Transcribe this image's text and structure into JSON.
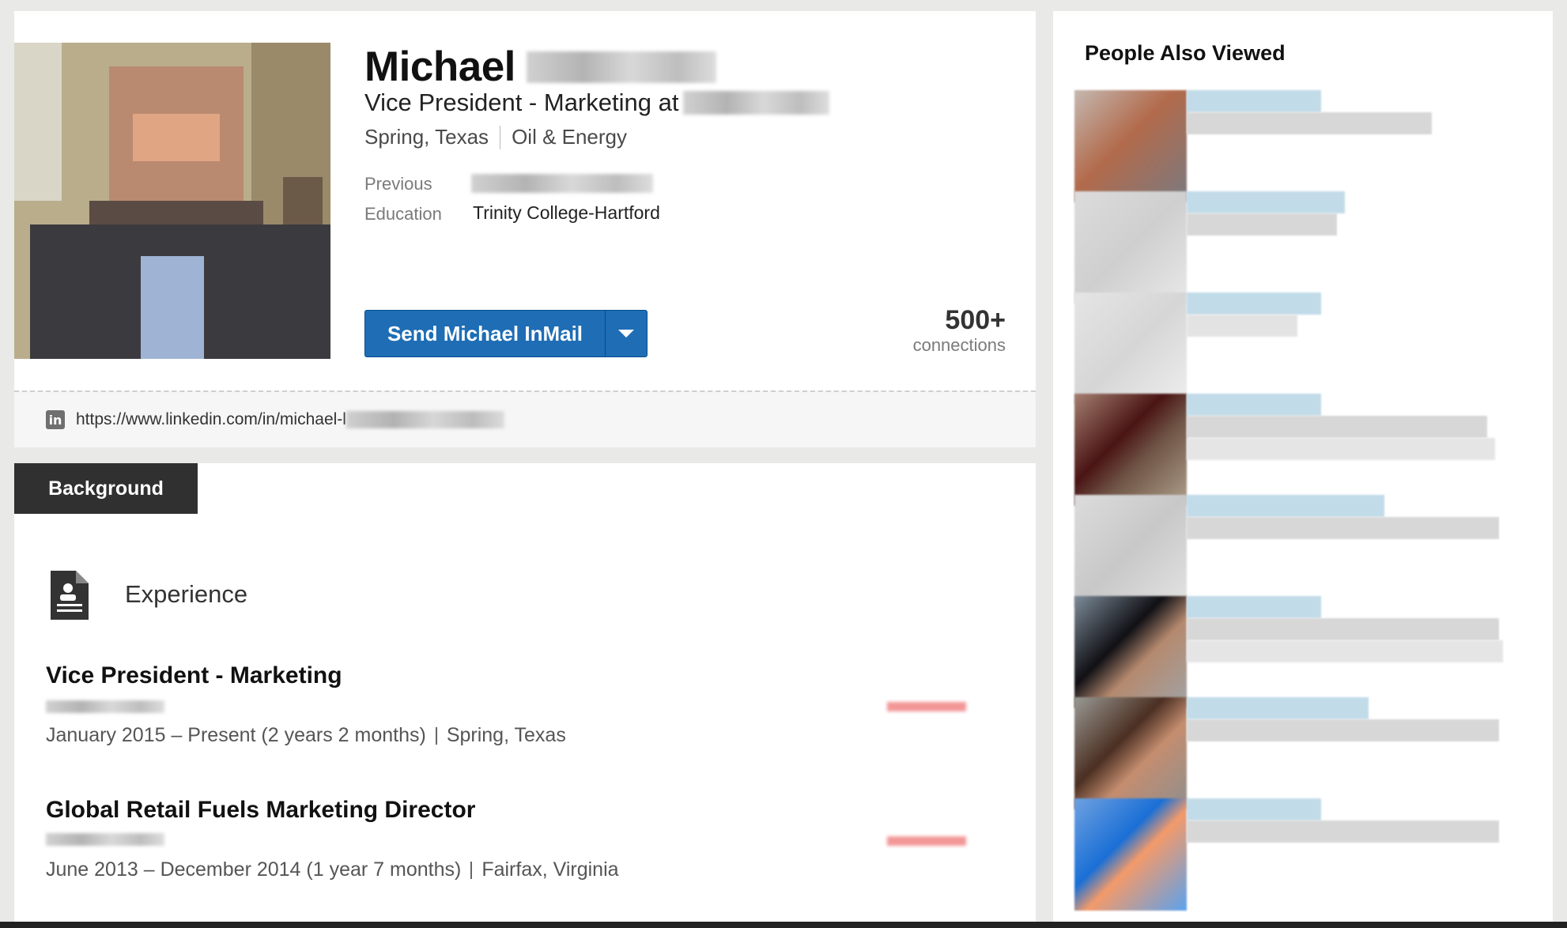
{
  "profile": {
    "first_name": "Michael",
    "headline_prefix": "Vice President - Marketing at",
    "location": "Spring, Texas",
    "industry": "Oil & Energy",
    "previous_label": "Previous",
    "education_label": "Education",
    "education_value": "Trinity College-Hartford",
    "inmail_label": "Send Michael InMail",
    "connections_count": "500+",
    "connections_label": "connections",
    "profile_url": "https://www.linkedin.com/in/michael-l",
    "linkedin_icon_glyph": "in"
  },
  "background": {
    "tab_label": "Background",
    "experience_title": "Experience",
    "jobs": [
      {
        "title": "Vice President - Marketing",
        "dates": "January 2015 – Present (2 years 2 months)",
        "location": "Spring, Texas"
      },
      {
        "title": "Global Retail Fuels Marketing Director",
        "dates": "June 2013 – December 2014 (1 year 7 months)",
        "location": "Fairfax, Virginia"
      }
    ]
  },
  "sidebar": {
    "title": "People Also Viewed",
    "item_count_visible": 8
  },
  "colors": {
    "accent": "#1e6db5",
    "tab_background": "#303030",
    "page_background": "#e9e9e7"
  },
  "icons": {
    "experience": "document-icon",
    "linkedin": "linkedin-icon",
    "dropdown": "caret-down-icon"
  }
}
